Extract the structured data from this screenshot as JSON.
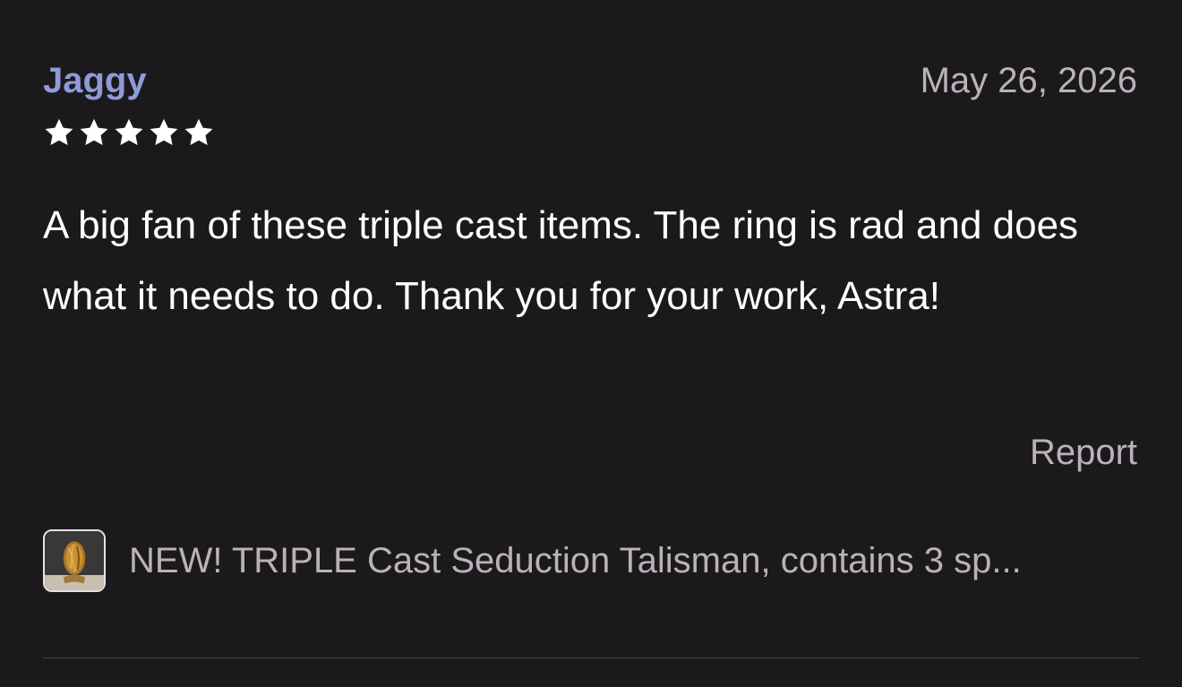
{
  "review": {
    "reviewer_name": "Jaggy",
    "date": "May 26, 2026",
    "rating": 5,
    "max_rating": 5,
    "body": "A big fan of these triple cast items. The ring is rad and does what it needs to do. Thank you for your work, Astra!",
    "report_label": "Report"
  },
  "product": {
    "title": "NEW! TRIPLE Cast Seduction Talisman, contains 3 sp...",
    "thumbnail_icon": "ring-product-thumbnail"
  },
  "colors": {
    "background": "#1c191c",
    "reviewer_name": "#8e9bd8",
    "muted_text": "#b8b3b8",
    "star": "#ffffff"
  }
}
